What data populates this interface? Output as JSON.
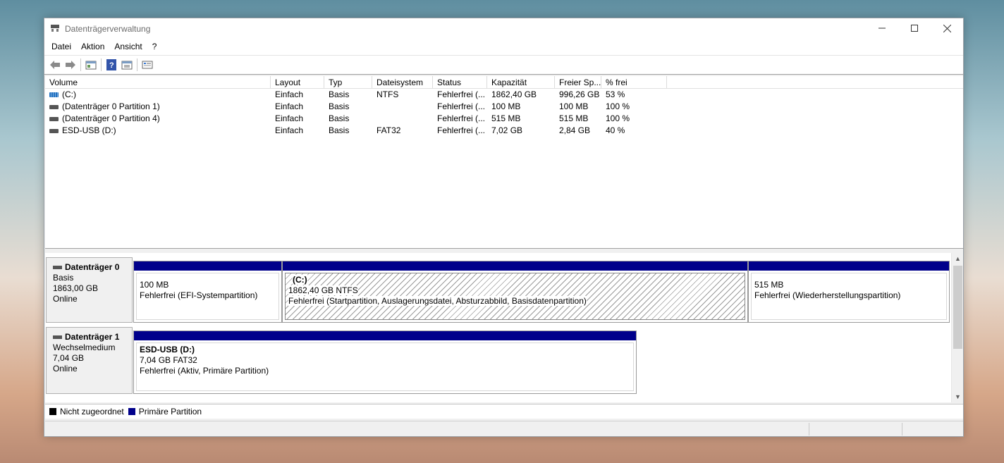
{
  "window": {
    "title": "Datenträgerverwaltung"
  },
  "menu": [
    "Datei",
    "Aktion",
    "Ansicht",
    "?"
  ],
  "toolbar": {
    "icons": [
      "back-arrow-icon",
      "forward-arrow-icon",
      "console-tree-icon",
      "help-icon",
      "properties-icon",
      "view-icon"
    ]
  },
  "volume_table": {
    "columns": [
      "Volume",
      "Layout",
      "Typ",
      "Dateisystem",
      "Status",
      "Kapazität",
      "Freier Sp...",
      "% frei"
    ],
    "rows": [
      [
        "(C:)",
        "Einfach",
        "Basis",
        "NTFS",
        "Fehlerfrei (...",
        "1862,40 GB",
        "996,26 GB",
        "53 %"
      ],
      [
        "(Datenträger 0 Partition 1)",
        "Einfach",
        "Basis",
        "",
        "Fehlerfrei (...",
        "100 MB",
        "100 MB",
        "100 %"
      ],
      [
        "(Datenträger 0 Partition 4)",
        "Einfach",
        "Basis",
        "",
        "Fehlerfrei (...",
        "515 MB",
        "515 MB",
        "100 %"
      ],
      [
        "ESD-USB (D:)",
        "Einfach",
        "Basis",
        "FAT32",
        "Fehlerfrei (...",
        "7,02 GB",
        "2,84 GB",
        "40 %"
      ]
    ]
  },
  "disks": [
    {
      "name": "Datenträger 0",
      "type": "Basis",
      "size": "1863,00 GB",
      "state": "Online",
      "partitions": [
        {
          "title": "",
          "line1": "100 MB",
          "line2": "Fehlerfrei (EFI-Systempartition)"
        },
        {
          "title": "(C:)",
          "line1": "1862,40 GB NTFS",
          "line2": "Fehlerfrei (Startpartition, Auslagerungsdatei, Absturzabbild, Basisdatenpartition)"
        },
        {
          "title": "",
          "line1": "515 MB",
          "line2": "Fehlerfrei (Wiederherstellungspartition)"
        }
      ]
    },
    {
      "name": "Datenträger 1",
      "type": "Wechselmedium",
      "size": "7,04 GB",
      "state": "Online",
      "partitions": [
        {
          "title": "ESD-USB  (D:)",
          "line1": "7,04 GB FAT32",
          "line2": "Fehlerfrei (Aktiv, Primäre Partition)"
        }
      ]
    }
  ],
  "legend": [
    {
      "label": "Nicht zugeordnet",
      "color": "#000000"
    },
    {
      "label": "Primäre Partition",
      "color": "#00008b"
    }
  ]
}
